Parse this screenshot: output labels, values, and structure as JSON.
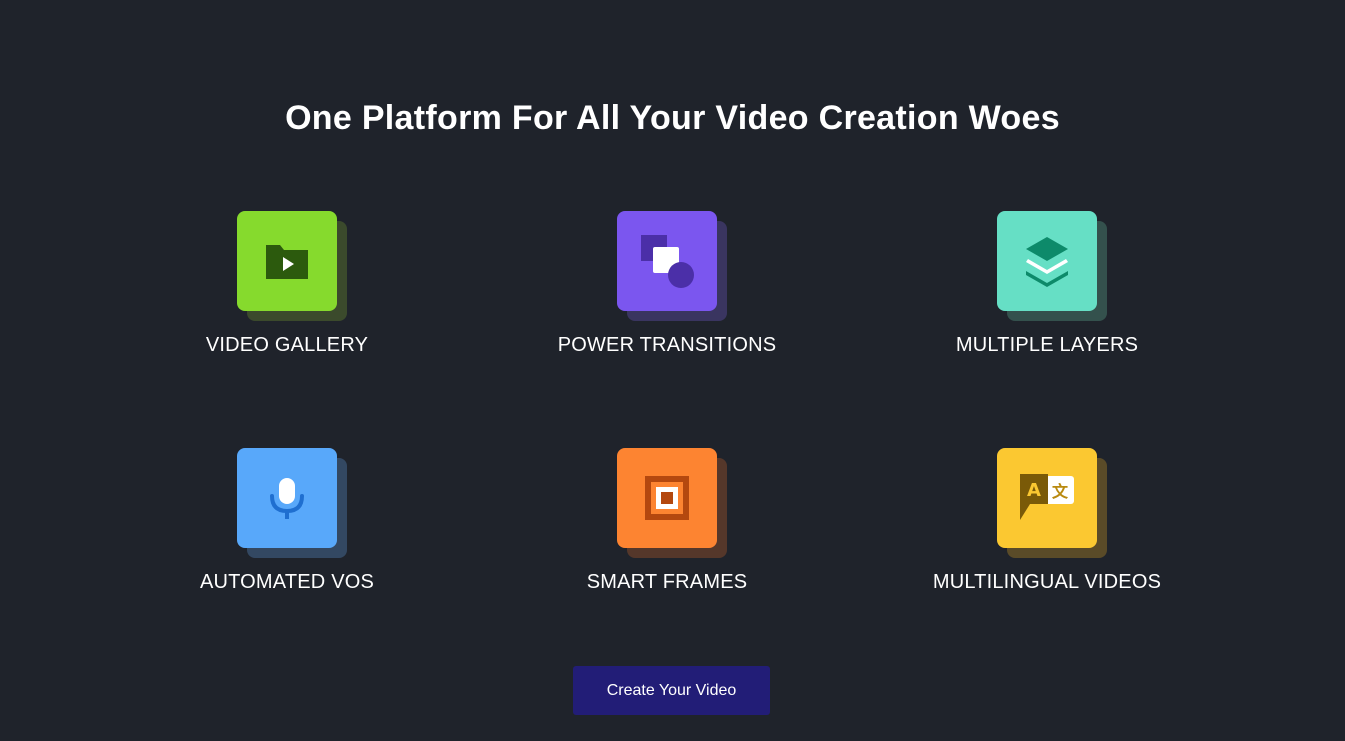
{
  "heading": "One Platform For All Your Video Creation Woes",
  "features": [
    {
      "label": "VIDEO GALLERY",
      "icon": "video-folder-icon",
      "color": "#86da2d",
      "shadow": "#3b4a2c"
    },
    {
      "label": "POWER TRANSITIONS",
      "icon": "shapes-icon",
      "color": "#7b56ef",
      "shadow": "#3a3560"
    },
    {
      "label": "MULTIPLE LAYERS",
      "icon": "layers-icon",
      "color": "#66dfc5",
      "shadow": "#34514d"
    },
    {
      "label": "AUTOMATED VOS",
      "icon": "microphone-icon",
      "color": "#58a8fa",
      "shadow": "#334862"
    },
    {
      "label": "SMART FRAMES",
      "icon": "frame-icon",
      "color": "#fd8431",
      "shadow": "#55372a"
    },
    {
      "label": "MULTILINGUAL VIDEOS",
      "icon": "translate-icon",
      "color": "#fbc831",
      "shadow": "#5a4b28"
    }
  ],
  "cta": {
    "label": "Create Your Video",
    "color": "#221d77"
  },
  "background": "#1f232b"
}
